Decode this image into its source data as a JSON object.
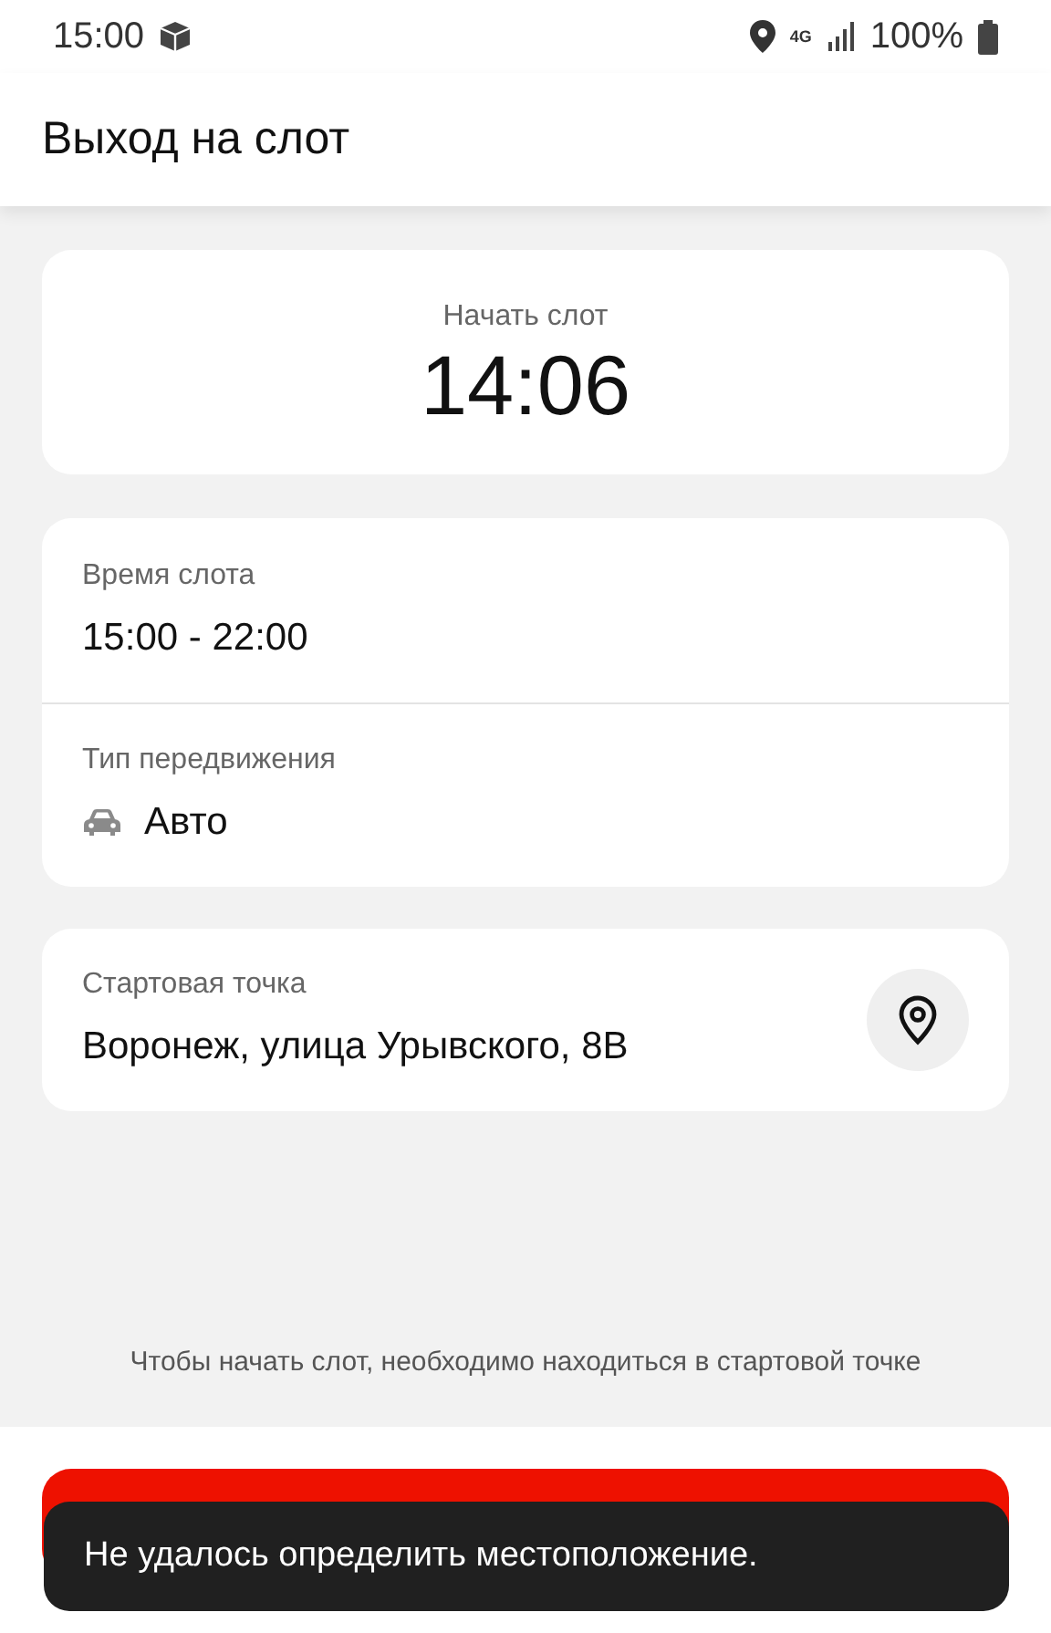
{
  "status_bar": {
    "time": "15:00",
    "network": "4G",
    "battery": "100%"
  },
  "header": {
    "title": "Выход на слот"
  },
  "start_card": {
    "label": "Начать слот",
    "time": "14:06"
  },
  "details": [
    {
      "label": "Время слота",
      "value": "15:00 - 22:00",
      "kind": "text"
    },
    {
      "label": "Тип передвижения",
      "value": "Авто",
      "kind": "vehicle"
    }
  ],
  "start_point": {
    "label": "Стартовая точка",
    "value": "Воронеж, улица Урывского, 8В"
  },
  "hint": "Чтобы начать слот, необходимо находиться в стартовой точке",
  "toast": "Не удалось определить местоположение."
}
